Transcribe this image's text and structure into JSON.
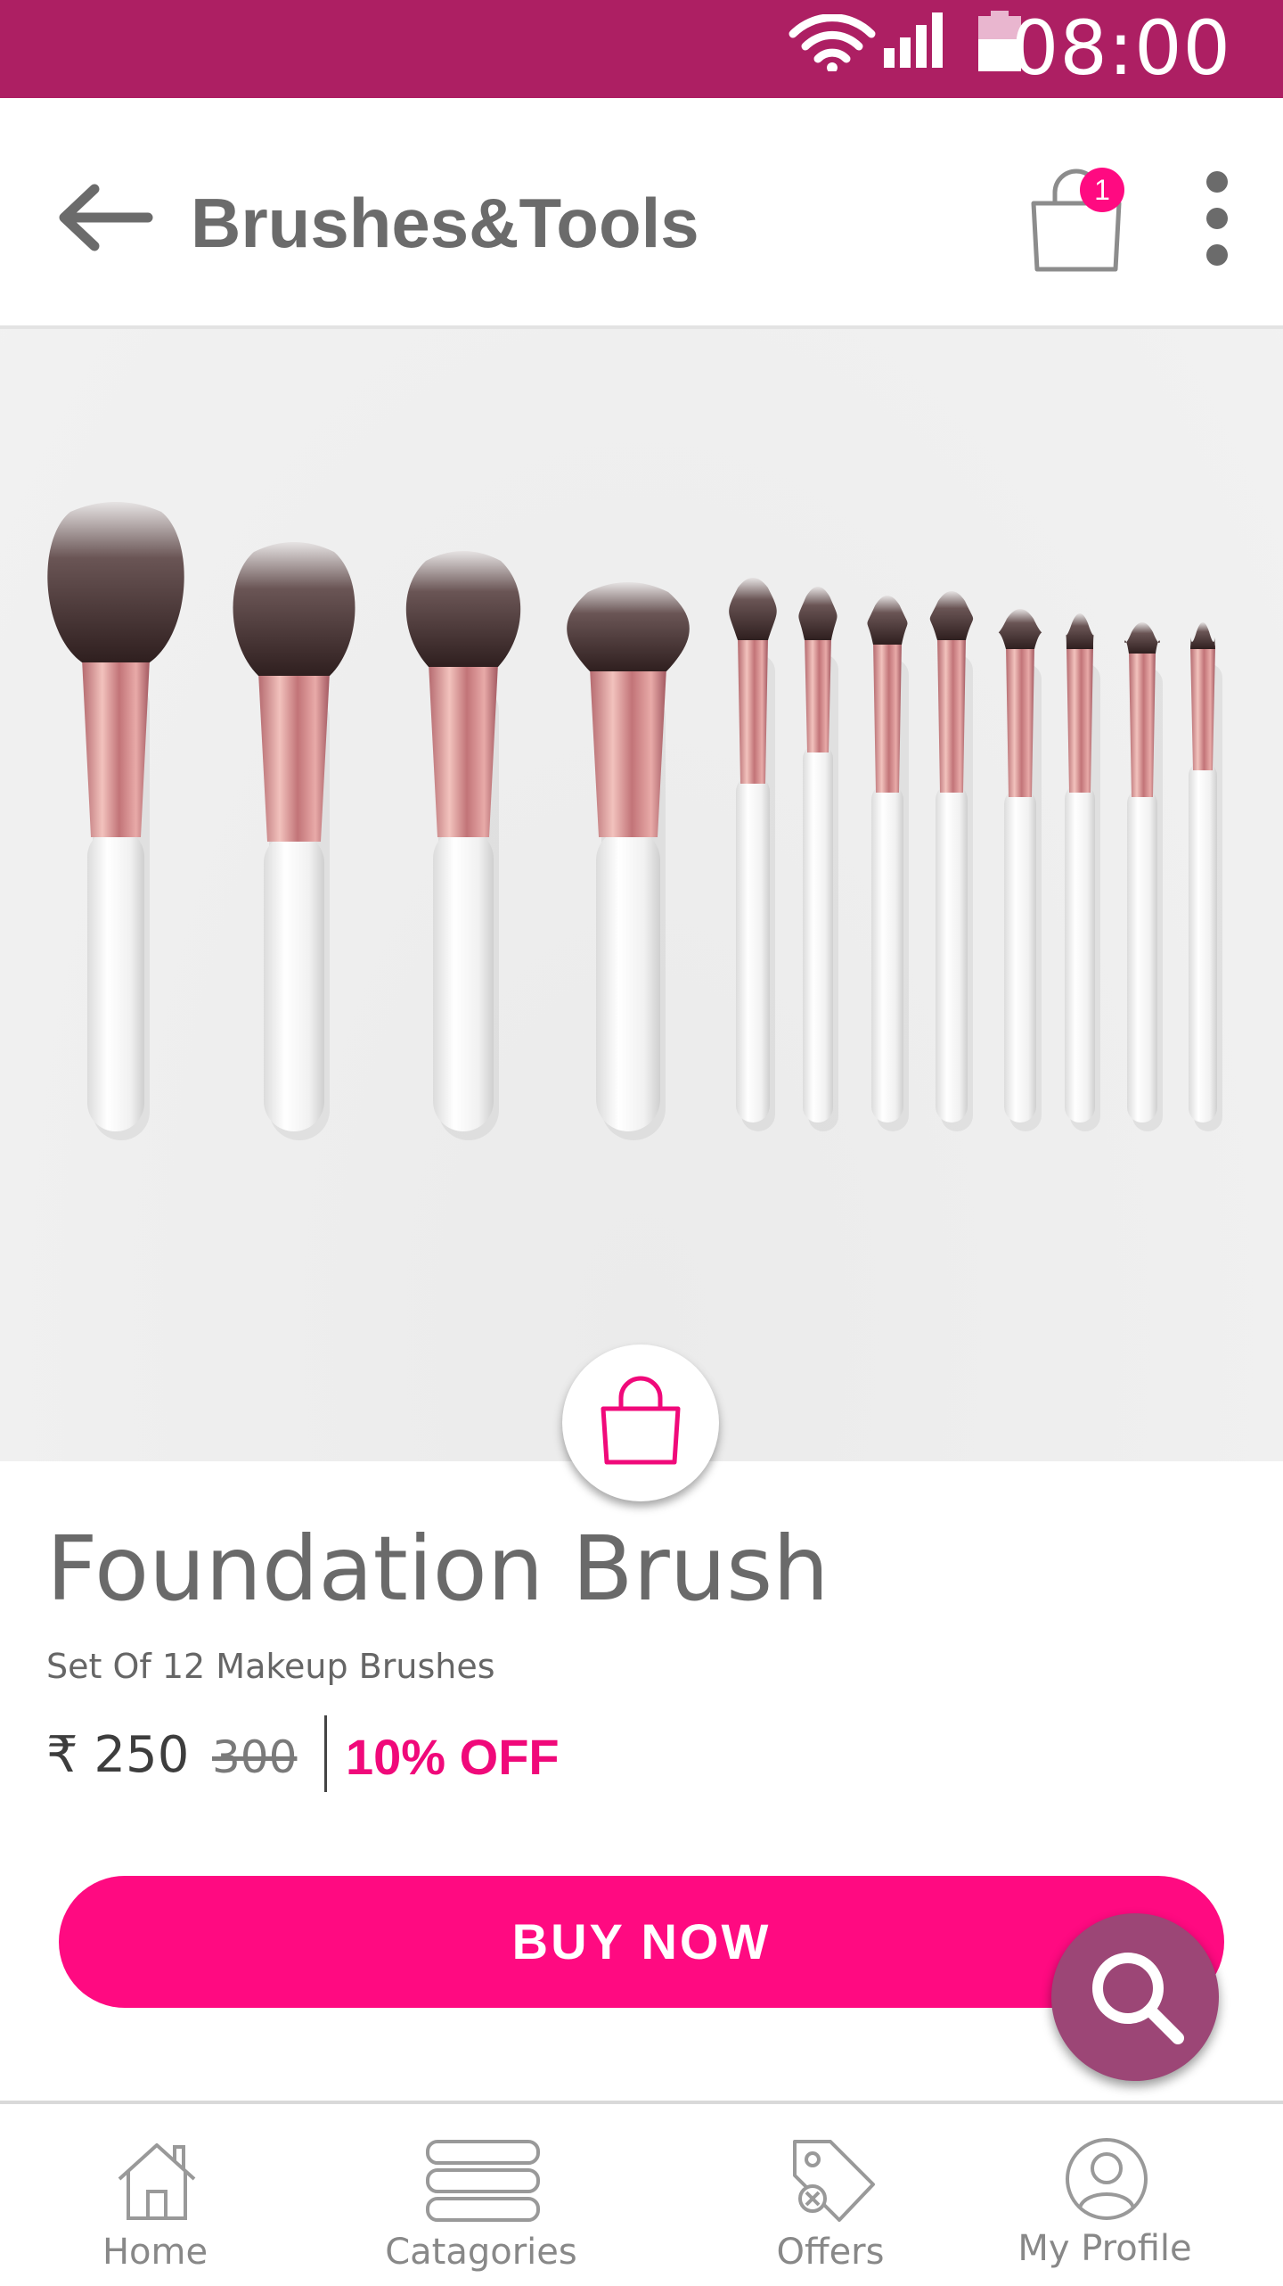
{
  "status_bar": {
    "time": "08:00",
    "background": "#ad1f63"
  },
  "app_bar": {
    "title": "Brushes&Tools",
    "cart_count": "1"
  },
  "product": {
    "name": "Foundation Brush",
    "subtitle": "Set Of 12 Makeup Brushes",
    "price": "₹ 250",
    "original_price": "300",
    "discount": "10% OFF"
  },
  "actions": {
    "buy_now": "BUY NOW"
  },
  "bottom_nav": {
    "items": [
      {
        "label": "Home",
        "icon": "home-icon"
      },
      {
        "label": "Catagories",
        "icon": "categories-icon"
      },
      {
        "label": "Offers",
        "icon": "offers-tag-icon"
      },
      {
        "label": "My Profile",
        "icon": "profile-icon"
      }
    ]
  },
  "colors": {
    "accent": "#ff0a81",
    "brand": "#ad1f63",
    "fab": "#9c4676"
  }
}
